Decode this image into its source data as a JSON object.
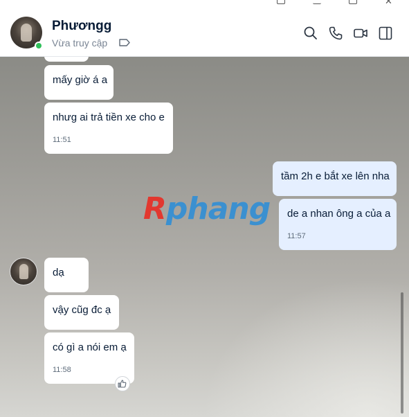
{
  "contact": {
    "name": "Phươngg",
    "status": "Vừa truy cập",
    "online": true
  },
  "header_icons": [
    "search-icon",
    "phone-icon",
    "video-icon",
    "sidebar-toggle-icon"
  ],
  "watermark": {
    "first": "R",
    "rest": "phang"
  },
  "messages": [
    {
      "dir": "in",
      "text": "mấy giờ á a"
    },
    {
      "dir": "in",
      "text": "nhưg ai trả tiền xe cho e",
      "time": "11:51"
    },
    {
      "dir": "out",
      "text": "tầm 2h e bắt xe lên nha"
    },
    {
      "dir": "out",
      "text": "de a nhan ông a của a",
      "time": "11:57"
    },
    {
      "dir": "in",
      "text": "dạ"
    },
    {
      "dir": "in",
      "text": "vậy cũg đc ạ"
    },
    {
      "dir": "in",
      "text": "có gì a nói em ạ",
      "time": "11:58"
    }
  ],
  "colors": {
    "incoming": "#ffffff",
    "outgoing": "#e5efff",
    "online": "#30c05a",
    "name": "#081c36"
  }
}
